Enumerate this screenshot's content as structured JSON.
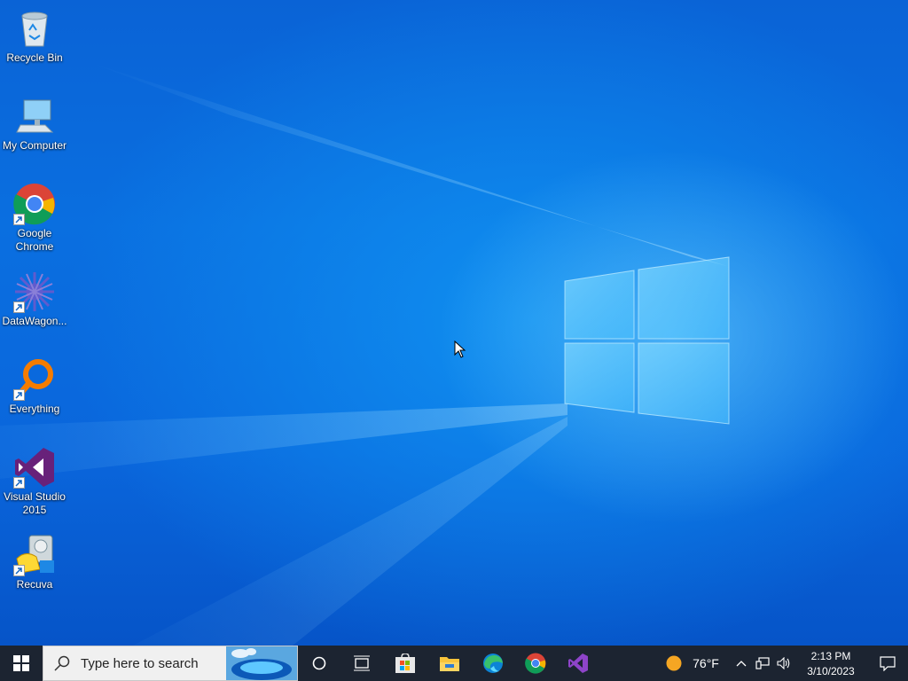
{
  "desktop": {
    "icons": [
      {
        "label": "Recycle Bin",
        "icon": "recycle-bin-icon"
      },
      {
        "label": "My Computer",
        "icon": "computer-icon"
      },
      {
        "label": "Google Chrome",
        "icon": "chrome-icon"
      },
      {
        "label": "DataWagon...",
        "icon": "datawagon-icon"
      },
      {
        "label": "Everything",
        "icon": "everything-search-icon"
      },
      {
        "label": "Visual Studio 2015",
        "icon": "visual-studio-icon"
      },
      {
        "label": "Recuva",
        "icon": "recuva-icon"
      }
    ]
  },
  "taskbar": {
    "search_placeholder": "Type here to search",
    "pinned": [
      {
        "name": "Cortana",
        "icon": "cortana-circle-icon"
      },
      {
        "name": "Task View",
        "icon": "task-view-icon"
      },
      {
        "name": "Microsoft Store",
        "icon": "store-icon"
      },
      {
        "name": "File Explorer",
        "icon": "file-explorer-icon"
      },
      {
        "name": "Microsoft Edge",
        "icon": "edge-icon"
      },
      {
        "name": "Google Chrome",
        "icon": "chrome-icon"
      },
      {
        "name": "Visual Studio",
        "icon": "visual-studio-icon"
      }
    ],
    "weather": {
      "temp": "76°F",
      "icon": "sun-icon"
    },
    "clock": {
      "time": "2:13 PM",
      "date": "3/10/2023"
    }
  },
  "colors": {
    "taskbar": "#1c2431",
    "desktop_accent": "#0a6fe0"
  }
}
